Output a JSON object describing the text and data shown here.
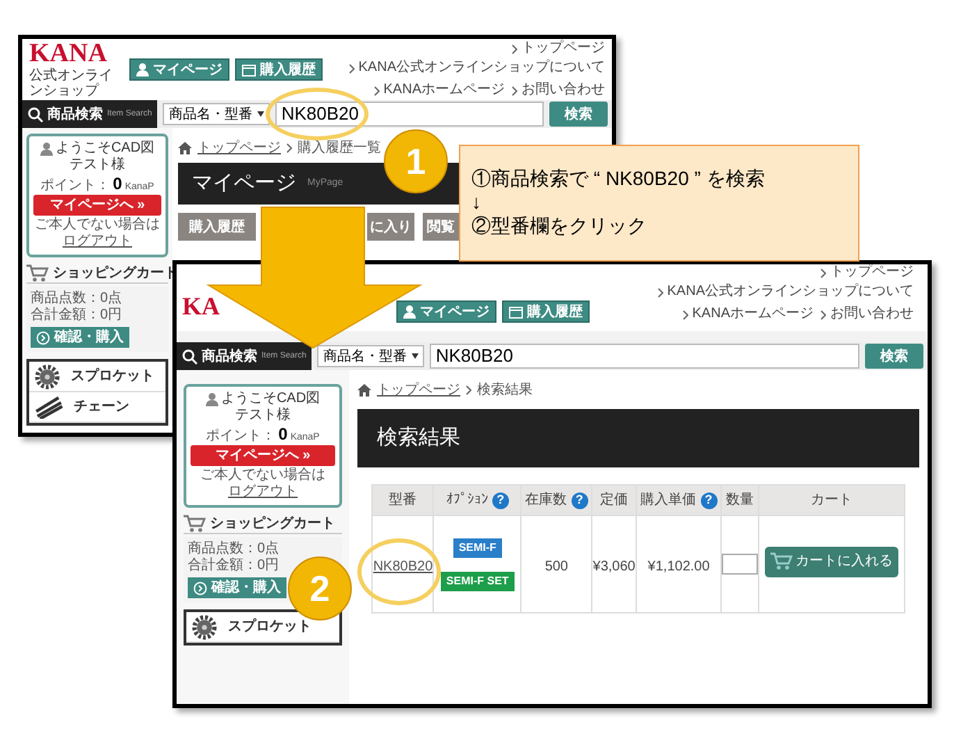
{
  "back_screenshot": {
    "logo": "KANA",
    "logo_subtitle": "公式オンラインショップ",
    "header_buttons": [
      "マイページ",
      "購入履歴"
    ],
    "header_links": [
      [
        "トップページ",
        "KANA公式オンラインショップについて"
      ],
      [
        "KANAホームページ",
        "お問い合わせ"
      ]
    ],
    "search": {
      "label": "商品検索",
      "sublabel": "Item Search",
      "select": "商品名・型番",
      "value": "NK80B20",
      "button": "検索"
    },
    "breadcrumb": [
      "トップページ",
      "購入履歴一覧"
    ],
    "sidebar": {
      "welcome_greeting": "ようこそCAD図",
      "welcome_name": "テスト様",
      "points_label": "ポイント：",
      "points": "0",
      "points_unit": "KanaP",
      "mypage_button": "マイページへ »",
      "logout_note": "ご本人でない場合は",
      "logout_link": "ログアウト",
      "cart_title": "ショッピングカート",
      "cart_count": "商品点数：0点",
      "cart_total": "合計金額：0円",
      "checkout_button": "確認・購入"
    },
    "categories": [
      "スプロケット",
      "チェーン"
    ],
    "page_title": "マイページ",
    "page_subtitle": "MyPage",
    "page_buttons": [
      "購入履歴",
      "に入り",
      "閲覧"
    ]
  },
  "front_screenshot": {
    "logo": "KA",
    "header_buttons": [
      "マイページ",
      "購入履歴"
    ],
    "header_links": [
      [
        "トップページ",
        "KANA公式オンラインショップについて"
      ],
      [
        "KANAホームページ",
        "お問い合わせ"
      ]
    ],
    "search": {
      "label": "商品検索",
      "sublabel": "Item Search",
      "select": "商品名・型番",
      "value": "NK80B20",
      "button": "検索"
    },
    "breadcrumb": [
      "トップページ",
      "検索結果"
    ],
    "sidebar": {
      "welcome_greeting": "ようこそCAD図",
      "welcome_name": "テスト様",
      "points_label": "ポイント：",
      "points": "0",
      "points_unit": "KanaP",
      "mypage_button": "マイページへ »",
      "logout_note": "ご本人でない場合は",
      "logout_link": "ログアウト",
      "cart_title": "ショッピングカート",
      "cart_count": "商品点数：0点",
      "cart_total": "合計金額：0円",
      "checkout_button": "確認・購入"
    },
    "categories": [
      "スプロケット"
    ],
    "page_title": "検索結果",
    "results_table": {
      "columns": [
        {
          "label": "型番"
        },
        {
          "label": "ｵﾌﾟｼｮﾝ",
          "help": "?"
        },
        {
          "label": "在庫数",
          "help": "?"
        },
        {
          "label": "定価"
        },
        {
          "label": "購入単価",
          "help": "?"
        },
        {
          "label": "数量"
        },
        {
          "label": "カート"
        }
      ],
      "rows": [
        {
          "model": "NK80B20",
          "options": [
            {
              "label": "SEMI-F",
              "color": "#2a7fc9"
            },
            {
              "label": "SEMI-F SET",
              "color": "#1d9e4a"
            }
          ],
          "stock": "500",
          "list_price": "¥3,060",
          "unit_price": "¥1,102.00",
          "cart_button": "カートに入れる"
        }
      ]
    }
  },
  "callout": {
    "lines": [
      "①商品検索で “ NK80B20 ” を検索",
      "↓",
      "②型番欄をクリック"
    ]
  },
  "step_markers": [
    {
      "label": "1"
    },
    {
      "label": "2"
    }
  ]
}
